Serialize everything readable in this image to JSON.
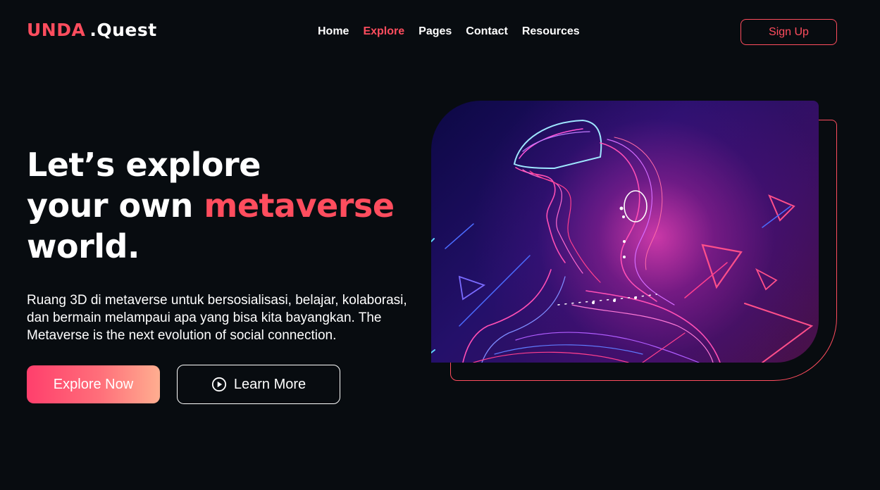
{
  "header": {
    "logo_brand": "UNDA",
    "logo_suffix": ".Quest",
    "nav": [
      {
        "label": "Home",
        "active": false
      },
      {
        "label": "Explore",
        "active": true
      },
      {
        "label": "Pages",
        "active": false
      },
      {
        "label": "Contact",
        "active": false
      },
      {
        "label": "Resources",
        "active": false
      }
    ],
    "signup_label": "Sign Up"
  },
  "hero": {
    "title_line1": "Let’s explore",
    "title_line2_prefix": "your own ",
    "title_line2_accent": "metaverse",
    "title_line3": "world.",
    "description": "Ruang 3D di metaverse untuk bersosialisasi, belajar, kolaborasi, dan bermain melampaui apa yang bisa kita bayangkan. The Metaverse is the next evolution of social connection.",
    "primary_button": "Explore Now",
    "secondary_button": "Learn More"
  },
  "colors": {
    "accent": "#ff4d5e",
    "background": "#080c10",
    "text": "#ffffff"
  },
  "icons": {
    "learn_more": "play-circle-icon"
  }
}
